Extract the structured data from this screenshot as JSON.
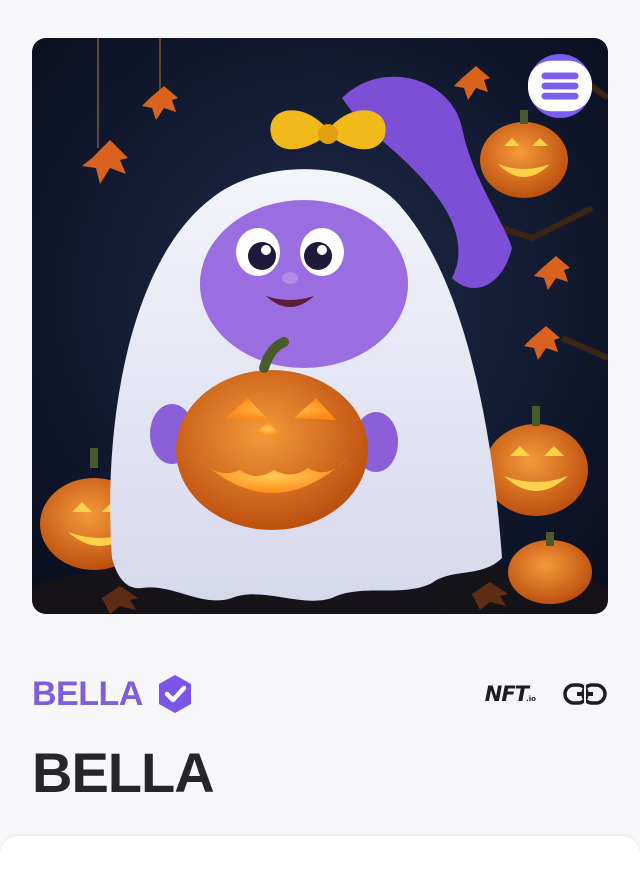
{
  "item": {
    "collection_name": "BELLA",
    "title": "BELLA",
    "verified": true
  },
  "marketplace": {
    "logo_text": "NFT",
    "logo_suffix": ".io"
  },
  "icons": {
    "badge": "enjin-logo-icon",
    "verified": "verified-check-icon",
    "link": "link-icon"
  },
  "colors": {
    "accent": "#7f5fd9",
    "badge": "#7b5cf0",
    "title": "#25252b",
    "background": "#f7f7f9"
  }
}
